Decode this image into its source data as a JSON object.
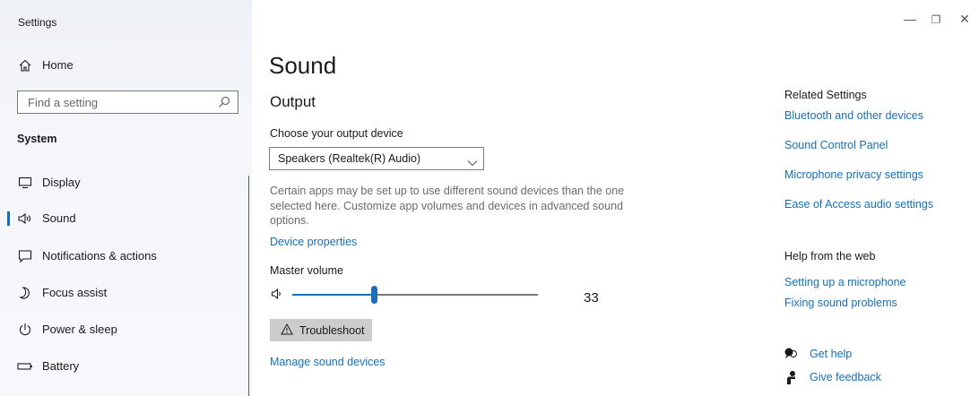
{
  "window": {
    "title": "Settings",
    "controls": {
      "minimize": "—",
      "restore": "❐",
      "close": "✕"
    }
  },
  "sidebar": {
    "home_label": "Home",
    "search": {
      "placeholder": "Find a setting",
      "value": ""
    },
    "section_label": "System",
    "items": [
      {
        "label": "Display",
        "icon": "monitor-icon"
      },
      {
        "label": "Sound",
        "icon": "speaker-icon",
        "selected": true
      },
      {
        "label": "Notifications & actions",
        "icon": "notification-icon"
      },
      {
        "label": "Focus assist",
        "icon": "moon-icon"
      },
      {
        "label": "Power & sleep",
        "icon": "power-icon"
      },
      {
        "label": "Battery",
        "icon": "battery-icon"
      }
    ]
  },
  "main": {
    "page_title": "Sound",
    "output": {
      "heading": "Output",
      "device_label": "Choose your output device",
      "device_value": "Speakers (Realtek(R) Audio)",
      "description": "Certain apps may be set up to use different sound devices than the one selected here. Customize app volumes and devices in advanced sound options.",
      "device_properties_link": "Device properties",
      "master_volume_label": "Master volume",
      "volume": 33,
      "volume_text": "33",
      "troubleshoot_label": "Troubleshoot",
      "manage_link": "Manage sound devices"
    }
  },
  "related": {
    "heading": "Related Settings",
    "links": [
      "Bluetooth and other devices",
      "Sound Control Panel",
      "Microphone privacy settings",
      "Ease of Access audio settings"
    ]
  },
  "help": {
    "heading": "Help from the web",
    "links": [
      "Setting up a microphone",
      "Fixing sound problems"
    ],
    "get_help": "Get help",
    "give_feedback": "Give feedback"
  },
  "colors": {
    "accent": "#1570b8",
    "selection_bar": "#0f6fb8"
  }
}
